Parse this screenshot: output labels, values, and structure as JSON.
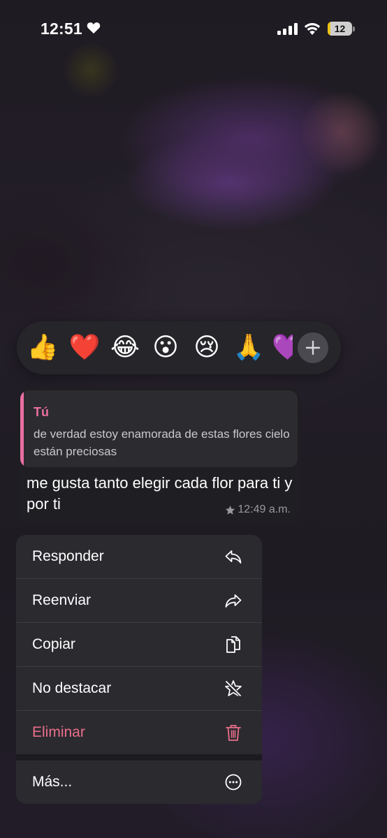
{
  "status_bar": {
    "time": "12:51",
    "battery_level": "12"
  },
  "reactions": {
    "emojis": [
      "👍",
      "❤️",
      "😂",
      "😮",
      "😢",
      "🙏",
      "💜"
    ],
    "more_icon": "plus-icon"
  },
  "message": {
    "quote_author": "Tú",
    "quote_text": "de verdad estoy enamorada de estas flores cielo están preciosas",
    "text": "me gusta tanto elegir cada flor para ti y por ti",
    "time": "12:49 a.m.",
    "starred_icon": "star-icon"
  },
  "menu": {
    "items": [
      {
        "label": "Responder",
        "icon": "reply-icon"
      },
      {
        "label": "Reenviar",
        "icon": "forward-icon"
      },
      {
        "label": "Copiar",
        "icon": "copy-icon"
      },
      {
        "label": "No destacar",
        "icon": "unstar-icon"
      },
      {
        "label": "Eliminar",
        "icon": "trash-icon"
      },
      {
        "label": "Más...",
        "icon": "more-icon"
      }
    ]
  },
  "colors": {
    "accent_pink": "#ea6fa1",
    "danger": "#ea6f8a",
    "battery_low": "#f0c419"
  }
}
